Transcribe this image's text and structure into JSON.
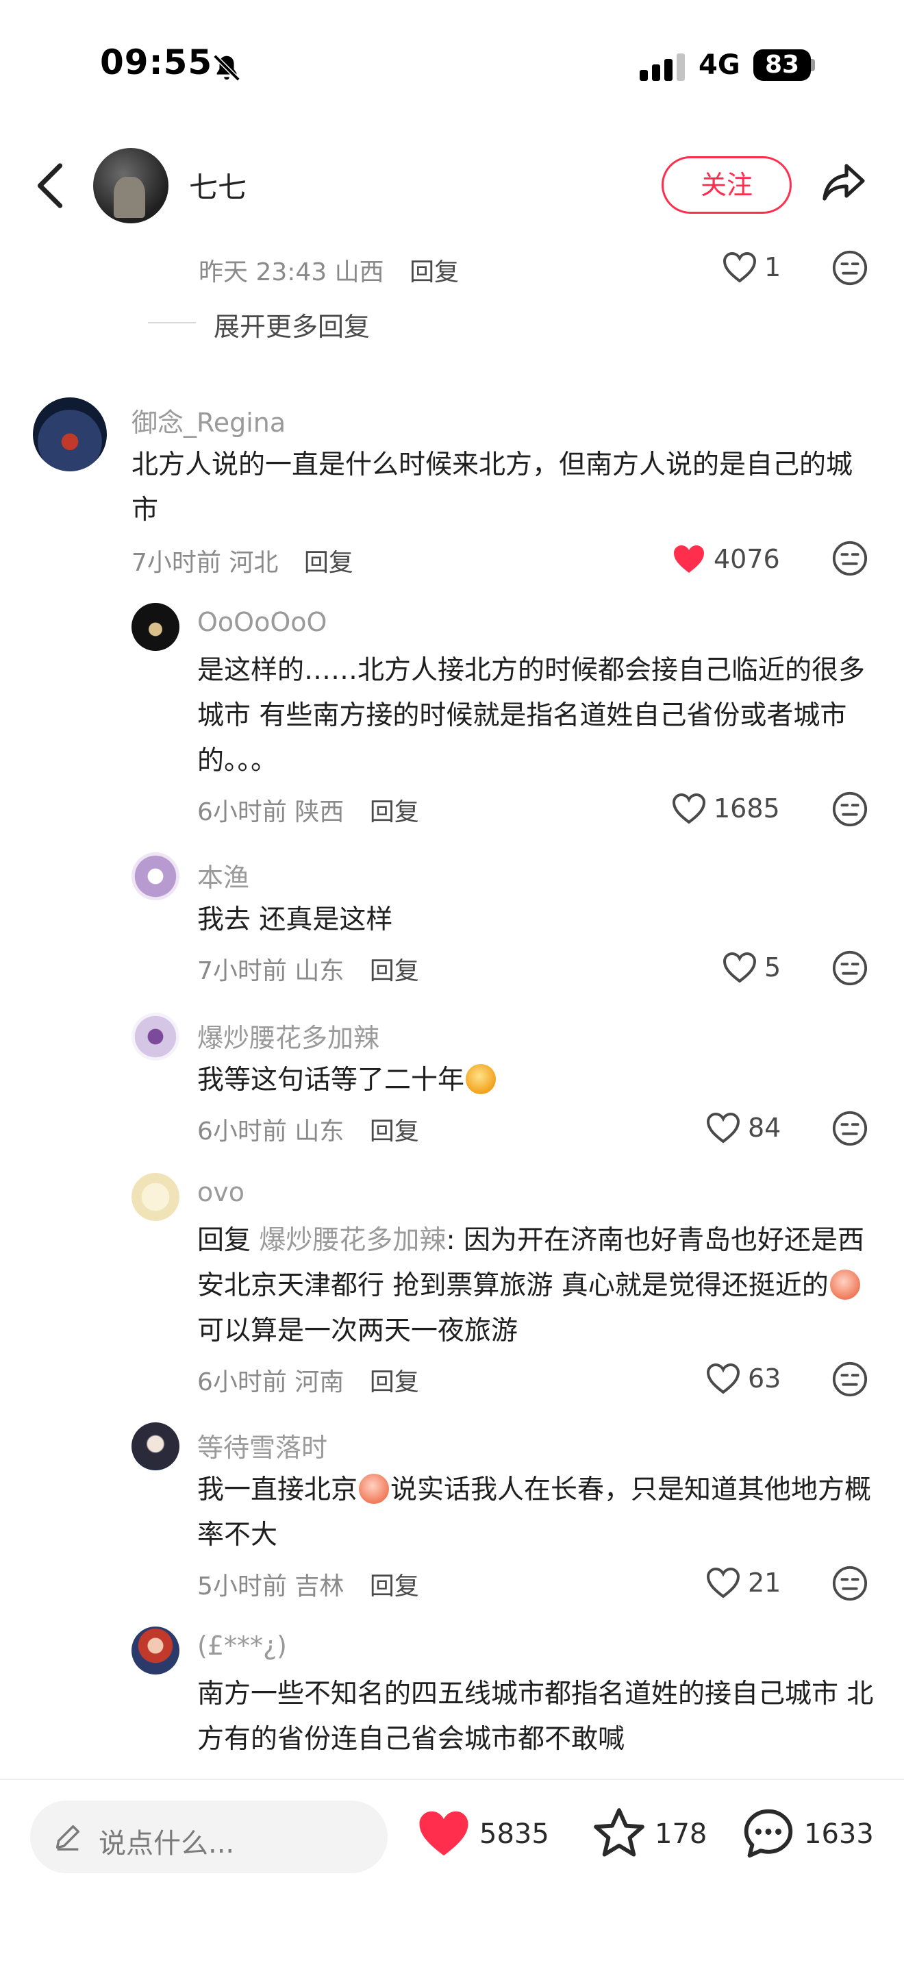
{
  "status_bar": {
    "time": "09:55",
    "network": "4G",
    "battery": "83"
  },
  "header": {
    "username": "七七",
    "follow_label": "关注"
  },
  "prev_reply": {
    "time": "昨天 23:43",
    "location": "山西",
    "reply_label": "回复",
    "likes": "1"
  },
  "expand_more": "展开更多回复",
  "comment": {
    "user": "御念_Regina",
    "text": "北方人说的一直是什么时候来北方，但南方人说的是自己的城市",
    "time": "7小时前",
    "location": "河北",
    "reply_label": "回复",
    "likes": "4076"
  },
  "replies": [
    {
      "user": "OoOoOoO",
      "text": "是这样的……北方人接北方的时候都会接自己临近的很多城市 有些南方接的时候就是指名道姓自己省份或者城市的。。。",
      "time": "6小时前",
      "location": "陕西",
      "reply_label": "回复",
      "likes": "1685"
    },
    {
      "user": "本渔",
      "text": "我去 还真是这样",
      "time": "7小时前",
      "location": "山东",
      "reply_label": "回复",
      "likes": "5"
    },
    {
      "user": "爆炒腰花多加辣",
      "text": "我等这句话等了二十年",
      "time": "6小时前",
      "location": "山东",
      "reply_label": "回复",
      "likes": "84"
    },
    {
      "user": "ovo",
      "reply_prefix": "回复",
      "mention": "爆炒腰花多加辣",
      "text_a": ": 因为开在济南也好青岛也好还是西安北京天津都行 抢到票算旅游 真心就是觉得还挺近的",
      "text_b": " 可以算是一次两天一夜旅游",
      "time": "6小时前",
      "location": "河南",
      "reply_label": "回复",
      "likes": "63"
    },
    {
      "user": "等待雪落时",
      "text_a": "我一直接北京",
      "text_b": "说实话我人在长春，只是知道其他地方概率不大",
      "time": "5小时前",
      "location": "吉林",
      "reply_label": "回复",
      "likes": "21"
    },
    {
      "user": "(£***¿)",
      "text": "南方一些不知名的四五线城市都指名道姓的接自己城市 北方有的省份连自己省会城市都不敢喊"
    }
  ],
  "bottom_bar": {
    "input_placeholder": "说点什么...",
    "likes": "5835",
    "favorites": "178",
    "comments": "1633"
  },
  "colors": {
    "accent": "#ff2e4d",
    "text": "#1f1f1f",
    "secondary": "#8a8a8a"
  }
}
